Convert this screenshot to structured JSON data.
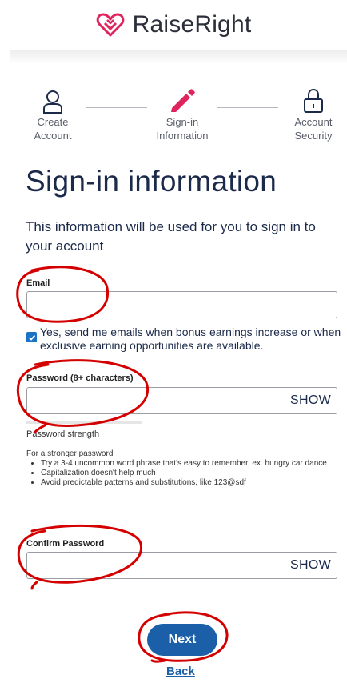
{
  "brand": {
    "name": "RaiseRight",
    "mark": "TM"
  },
  "steps": [
    {
      "line1": "Create",
      "line2": "Account",
      "icon": "user-icon"
    },
    {
      "line1": "Sign-in",
      "line2": "Information",
      "icon": "pencil-icon"
    },
    {
      "line1": "Account",
      "line2": "Security",
      "icon": "lock-icon"
    }
  ],
  "page": {
    "title": "Sign-in information",
    "subtitle": "This information will be used for you to sign in to your account"
  },
  "email": {
    "label": "Email",
    "value": ""
  },
  "opt_in": {
    "checked": true,
    "text": "Yes, send me emails when bonus earnings increase or when exclusive earning opportunities are available."
  },
  "password": {
    "label": "Password (8+ characters)",
    "value": "",
    "show_label": "SHOW",
    "strength_label": "Password strength",
    "strength": 0
  },
  "tips": {
    "heading": "For a stronger password",
    "items": [
      "Try a 3-4 uncommon word phrase that's easy to remember, ex. hungry car dance",
      "Capitalization doesn't help much",
      "Avoid predictable patterns and substitutions, like 123@sdf"
    ]
  },
  "confirm_password": {
    "label": "Confirm Password",
    "value": "",
    "show_label": "SHOW"
  },
  "actions": {
    "next_label": "Next",
    "back_label": "Back"
  },
  "colors": {
    "brand_pink": "#e0245e",
    "primary_blue": "#1b5fa8",
    "annotation_red": "#d40000"
  }
}
